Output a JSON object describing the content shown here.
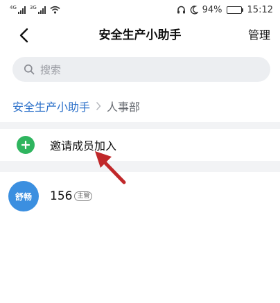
{
  "status_bar": {
    "signal_1_tag": "4G",
    "signal_2_tag": "3G",
    "battery_percent": "94%",
    "battery_level": 0.94,
    "time": "15:12"
  },
  "nav": {
    "title": "安全生产小助手",
    "manage_label": "管理"
  },
  "search": {
    "placeholder": "搜索"
  },
  "breadcrumb": {
    "root": "安全生产小助手",
    "current": "人事部"
  },
  "invite": {
    "label": "邀请成员加入"
  },
  "members": [
    {
      "avatar_text": "舒畅",
      "name": "156",
      "badge": "主管"
    }
  ],
  "colors": {
    "accent_blue": "#2a6fc9",
    "invite_green": "#2fb55f",
    "avatar_blue": "#3b8fe0",
    "arrow_red": "#c0282a",
    "band_gray": "#f2f3f5"
  }
}
